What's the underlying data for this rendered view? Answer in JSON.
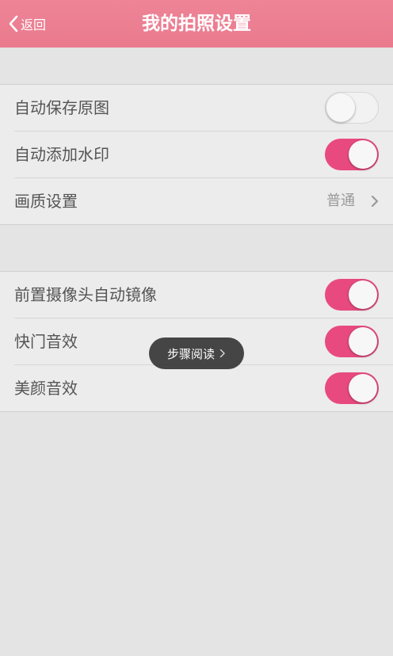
{
  "header": {
    "back_label": "返回",
    "title": "我的拍照设置",
    "back_icon": "chevron-left-icon"
  },
  "colors": {
    "header_bg": "#ec7f93",
    "toggle_on": "#e84a7f",
    "background": "#e4e4e4"
  },
  "group1": {
    "rows": [
      {
        "label": "自动保存原图",
        "type": "toggle",
        "on": false
      },
      {
        "label": "自动添加水印",
        "type": "toggle",
        "on": true
      },
      {
        "label": "画质设置",
        "type": "link",
        "value": "普通",
        "icon": "chevron-right-icon"
      }
    ]
  },
  "group2": {
    "rows": [
      {
        "label": "前置摄像头自动镜像",
        "type": "toggle",
        "on": true
      },
      {
        "label": "快门音效",
        "type": "toggle",
        "on": true
      },
      {
        "label": "美颜音效",
        "type": "toggle",
        "on": true
      }
    ]
  },
  "toast": {
    "label": "步骤阅读",
    "icon": "chevron-right-icon"
  }
}
